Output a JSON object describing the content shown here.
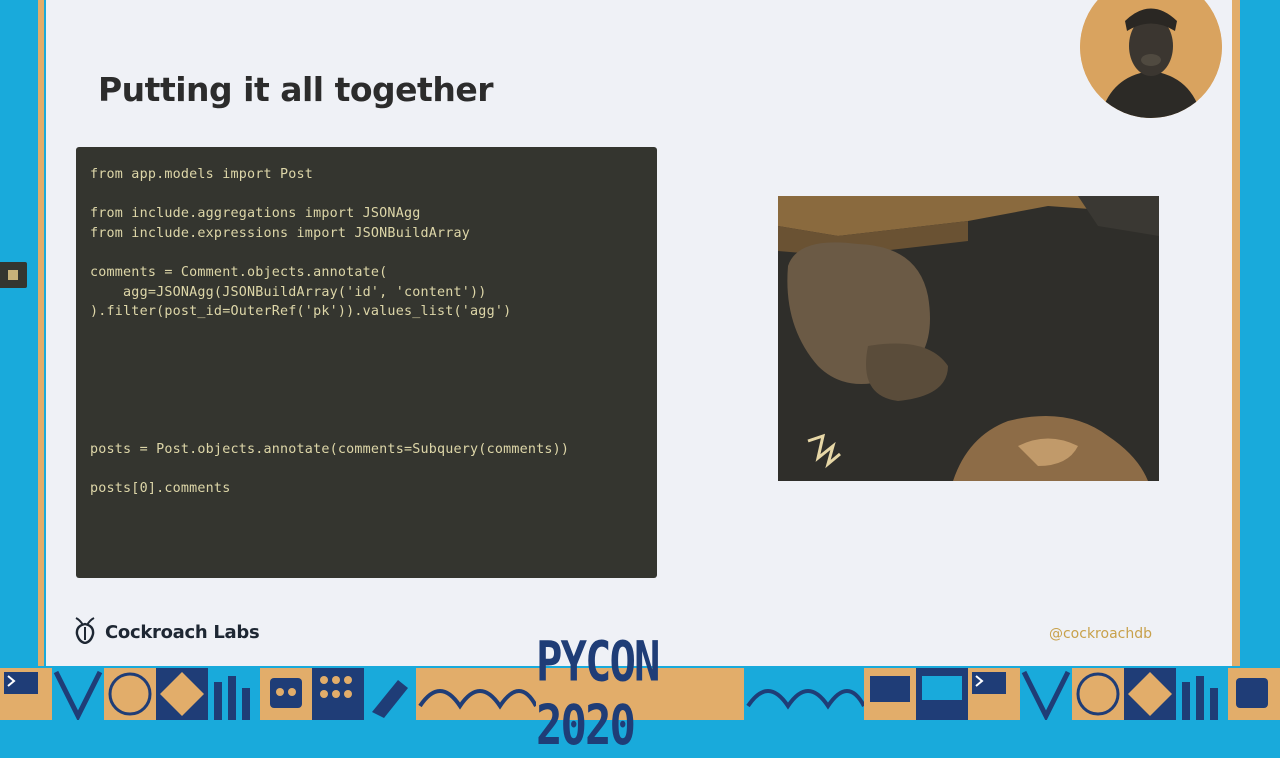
{
  "slide": {
    "title": "Putting it all together",
    "code_lines": [
      "from app.models import Post",
      "from include.aggregations import JSONAgg",
      "from include.expressions import JSONBuildArray",
      "comments = Comment.objects.annotate(",
      "    agg=JSONAgg(JSONBuildArray('id', 'content'))",
      ").filter(post_id=OuterRef('pk')).values_list('agg')",
      "posts = Post.objects.annotate(comments=Subquery(comments))",
      "posts[0].comments"
    ],
    "brand": "Cockroach Labs",
    "handle": "@cockroachdb"
  },
  "footer": {
    "event_logo": "PYCON 2020"
  },
  "colors": {
    "slide_bg": "#eff1f6",
    "code_bg": "#34352f",
    "code_text": "#ddd6a8",
    "accent_blue": "#19aadb",
    "accent_gold": "#e2ad6a",
    "footer_navy": "#1f3d77"
  },
  "icons": [
    "cockroach-logo-icon",
    "line-marker-icon",
    "speaker-webcam",
    "video-feed"
  ]
}
